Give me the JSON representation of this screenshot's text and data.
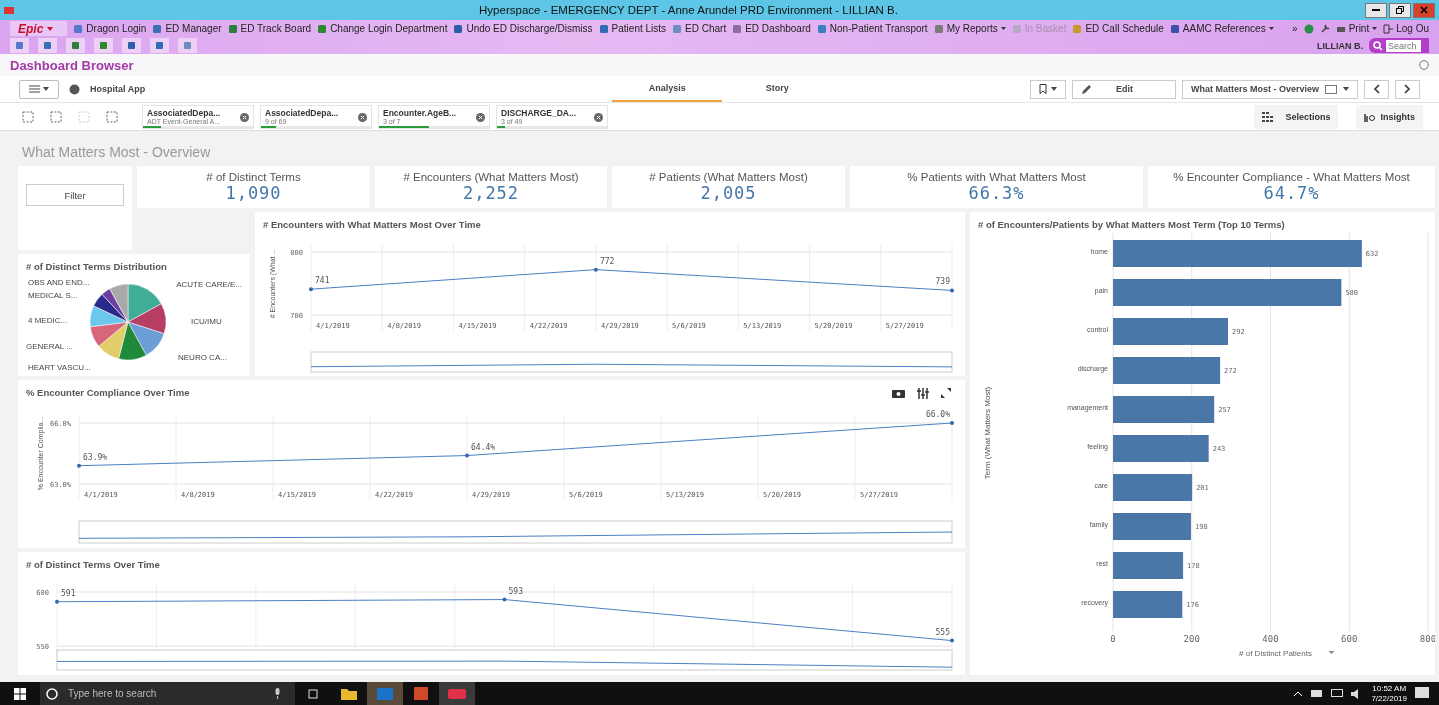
{
  "window": {
    "title": "Hyperspace - EMERGENCY DEPT - Anne Arundel PRD Environment - LILLIAN B."
  },
  "epic_toolbar": {
    "logo": "Epic",
    "items": [
      {
        "label": "Dragon Login",
        "disabled": false,
        "dropdown": false
      },
      {
        "label": "ED Manager",
        "disabled": false,
        "dropdown": false
      },
      {
        "label": "ED Track Board",
        "disabled": false,
        "dropdown": false
      },
      {
        "label": "Change Login Department",
        "disabled": false,
        "dropdown": false
      },
      {
        "label": "Undo ED Discharge/Dismiss",
        "disabled": false,
        "dropdown": false
      },
      {
        "label": "Patient Lists",
        "disabled": false,
        "dropdown": false
      },
      {
        "label": "ED Chart",
        "disabled": false,
        "dropdown": false
      },
      {
        "label": "ED Dashboard",
        "disabled": false,
        "dropdown": false
      },
      {
        "label": "Non-Patient Transport",
        "disabled": false,
        "dropdown": false
      },
      {
        "label": "My Reports",
        "disabled": false,
        "dropdown": true
      },
      {
        "label": "In Basket",
        "disabled": true,
        "dropdown": false
      },
      {
        "label": "ED Call Schedule",
        "disabled": false,
        "dropdown": false
      },
      {
        "label": "AAMC References",
        "disabled": false,
        "dropdown": true
      }
    ],
    "more": "»",
    "print": "Print",
    "logout": "Log Ou",
    "user": "LILLIAN B.",
    "search_placeholder": "Search"
  },
  "activity": {
    "title": "Dashboard Browser"
  },
  "app_bar": {
    "app_name": "Hospital App",
    "tabs": [
      {
        "label": "Analysis",
        "selected": true
      },
      {
        "label": "Story",
        "selected": false
      }
    ],
    "edit": "Edit",
    "sheet": "What Matters Most - Overview"
  },
  "selections": {
    "chips": [
      {
        "field": "AssociatedDepa...",
        "detail": "ADT Event-General A...",
        "level": 0.16
      },
      {
        "field": "AssociatedDepa...",
        "detail": "9 of 69",
        "level": 0.14
      },
      {
        "field": "Encounter.AgeB...",
        "detail": "3 of 7",
        "level": 0.45
      },
      {
        "field": "DISCHARGE_DA...",
        "detail": "3 of 49",
        "level": 0.07
      }
    ],
    "selections_button": "Selections",
    "insights_button": "Insights"
  },
  "sheet": {
    "title": "What Matters Most - Overview",
    "filter": "Filter",
    "kpis": [
      {
        "label": "# of Distinct Terms",
        "value": "1,090"
      },
      {
        "label": "# Encounters (What Matters Most)",
        "value": "2,252"
      },
      {
        "label": "# Patients (What Matters Most)",
        "value": "2,005"
      },
      {
        "label": "% Patients with What Matters Most",
        "value": "66.3%"
      },
      {
        "label": "% Encounter Compliance - What Matters Most",
        "value": "64.7%"
      }
    ],
    "distribution": {
      "title": "# of Distinct Terms Distribution",
      "labels": [
        "OBS AND END...",
        "MEDICAL S...",
        "4 MEDIC...",
        "GENERAL ...",
        "HEART VASCU...",
        "ACUTE CARE/E...",
        "ICU/IMU",
        "NEURO CA..."
      ]
    },
    "encounters_chart": {
      "chart_data": {
        "type": "line",
        "title": "# Encounters with What Matters Most Over Time",
        "ylabel": "# Encounters (What ...",
        "ylim": [
          700,
          800
        ],
        "yticks": [
          700,
          800
        ],
        "categories": [
          "4/1/2019",
          "4/8/2019",
          "4/15/2019",
          "4/22/2019",
          "4/29/2019",
          "5/6/2019",
          "5/13/2019",
          "5/20/2019",
          "5/27/2019",
          null
        ],
        "series": [
          {
            "color": "#4a7fc1",
            "values": [
              741,
              null,
              null,
              null,
              772,
              null,
              null,
              null,
              null,
              739
            ]
          }
        ],
        "value_labels": [
          "741",
          "772",
          "739"
        ],
        "grid": true
      }
    },
    "compliance_chart": {
      "chart_data": {
        "type": "line",
        "title": "% Encounter Compliance Over Time",
        "ylabel": "% Encounter Complia...",
        "ylim": [
          63,
          66
        ],
        "yticks": [
          {
            "value": 63,
            "label": "63.0%"
          },
          {
            "value": 66,
            "label": "66.0%"
          }
        ],
        "categories": [
          "4/1/2019",
          "4/8/2019",
          "4/15/2019",
          "4/22/2019",
          "4/29/2019",
          "5/6/2019",
          "5/13/2019",
          "5/20/2019",
          "5/27/2019",
          null
        ],
        "series": [
          {
            "color": "#4a7fc1",
            "values": [
              63.9,
              null,
              null,
              null,
              64.4,
              null,
              null,
              null,
              null,
              66.0
            ]
          }
        ],
        "value_labels": [
          "63.9%",
          "64.4%",
          "66.0%"
        ],
        "grid": true
      }
    },
    "terms_chart": {
      "chart_data": {
        "type": "line",
        "title": "# of Distinct Terms Over Time",
        "ylim": [
          550,
          600
        ],
        "yticks": [
          550,
          600
        ],
        "categories": [
          null,
          null,
          null
        ],
        "series": [
          {
            "color": "#4a7fc1",
            "values": [
              591,
              593,
              555
            ]
          }
        ],
        "value_labels": [
          "591",
          "593",
          "555"
        ],
        "grid": true
      }
    },
    "bar_chart": {
      "chart_data": {
        "type": "bar",
        "orientation": "horizontal",
        "title": "# of Encounters/Patients by What Matters Most Term (Top 10 Terms)",
        "xlabel": "# of Distinct Patients",
        "ylabel": "Term (What Matters Most)",
        "categories": [
          "home",
          "pain",
          "control",
          "discharge",
          "management",
          "feeling",
          "care",
          "family",
          "rest",
          "recovery"
        ],
        "series": [
          {
            "color": "#4a77a8",
            "values": [
              632,
              580,
              292,
              272,
              257,
              243,
              201,
              198,
              178,
              176
            ]
          }
        ],
        "xlim": [
          0,
          800
        ],
        "xticks": [
          0,
          200,
          400,
          600,
          800
        ],
        "data_labels": true,
        "grid": true
      }
    }
  },
  "taskbar": {
    "search_placeholder": "Type here to search",
    "time": "10:52 AM",
    "date": "7/22/2019"
  }
}
